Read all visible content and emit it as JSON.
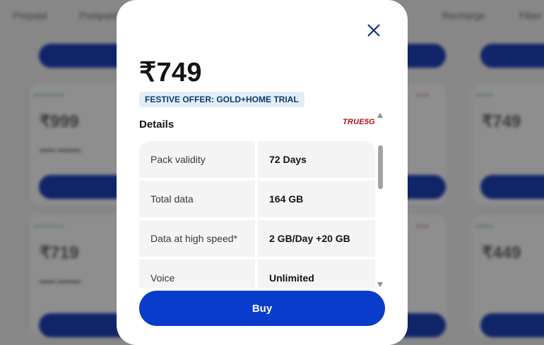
{
  "background": {
    "nav_items": [
      "Prepaid",
      "Postpaid",
      "Recharge",
      "Fiber"
    ],
    "card_prices": [
      "₹999",
      "₹719",
      "₹749",
      "₹449"
    ]
  },
  "modal": {
    "price": "₹749",
    "offer_badge": "FESTIVE OFFER: GOLD+HOME TRIAL",
    "details_heading": "Details",
    "network_tag": "TRUE5G",
    "details": [
      {
        "label": "Pack validity",
        "value": "72 Days"
      },
      {
        "label": "Total data",
        "value": "164 GB"
      },
      {
        "label": "Data at high speed*",
        "value": "2 GB/Day +20 GB"
      },
      {
        "label": "Voice",
        "value": "Unlimited"
      }
    ],
    "buy_label": "Buy"
  },
  "colors": {
    "primary": "#0a3ccc",
    "offer_badge_bg": "#e2eef7",
    "network_tag": "#b5121b"
  },
  "icons": {
    "close": "close-icon",
    "scroll_up": "scroll-up-arrow-icon",
    "scroll_down": "scroll-down-arrow-icon"
  }
}
